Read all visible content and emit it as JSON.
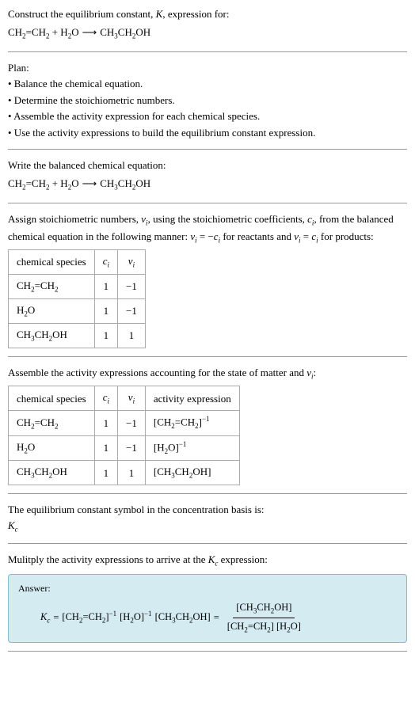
{
  "section1": {
    "intro": "Construct the equilibrium constant, K, expression for:",
    "equation": "CH₂=CH₂ + H₂O ⟶ CH₃CH₂OH"
  },
  "section2": {
    "title": "Plan:",
    "items": [
      "• Balance the chemical equation.",
      "• Determine the stoichiometric numbers.",
      "• Assemble the activity expression for each chemical species.",
      "• Use the activity expressions to build the equilibrium constant expression."
    ]
  },
  "section3": {
    "intro": "Write the balanced chemical equation:",
    "equation": "CH₂=CH₂ + H₂O ⟶ CH₃CH₂OH"
  },
  "section4": {
    "intro_part1": "Assign stoichiometric numbers, ",
    "intro_vi": "νᵢ",
    "intro_part2": ", using the stoichiometric coefficients, ",
    "intro_ci": "cᵢ",
    "intro_part3": ", from the balanced chemical equation in the following manner: ",
    "intro_eq1": "νᵢ = −cᵢ",
    "intro_part4": " for reactants and ",
    "intro_eq2": "νᵢ = cᵢ",
    "intro_part5": " for products:",
    "table": {
      "headers": [
        "chemical species",
        "cᵢ",
        "νᵢ"
      ],
      "rows": [
        [
          "CH₂=CH₂",
          "1",
          "−1"
        ],
        [
          "H₂O",
          "1",
          "−1"
        ],
        [
          "CH₃CH₂OH",
          "1",
          "1"
        ]
      ]
    }
  },
  "section5": {
    "intro": "Assemble the activity expressions accounting for the state of matter and νᵢ:",
    "table": {
      "headers": [
        "chemical species",
        "cᵢ",
        "νᵢ",
        "activity expression"
      ],
      "rows": [
        {
          "species": "CH₂=CH₂",
          "ci": "1",
          "vi": "−1",
          "activity": "[CH₂=CH₂]⁻¹"
        },
        {
          "species": "H₂O",
          "ci": "1",
          "vi": "−1",
          "activity": "[H₂O]⁻¹"
        },
        {
          "species": "CH₃CH₂OH",
          "ci": "1",
          "vi": "1",
          "activity": "[CH₃CH₂OH]"
        }
      ]
    }
  },
  "section6": {
    "intro": "The equilibrium constant symbol in the concentration basis is:",
    "symbol": "K_c"
  },
  "section7": {
    "intro": "Mulitply the activity expressions to arrive at the K_c expression:"
  },
  "answer": {
    "label": "Answer:",
    "kc": "K_c",
    "equals": " = ",
    "term1": "[CH₂=CH₂]⁻¹",
    "term2": "[H₂O]⁻¹",
    "term3": "[CH₃CH₂OH]",
    "equals2": " = ",
    "fraction_num": "[CH₃CH₂OH]",
    "fraction_den": "[CH₂=CH₂] [H₂O]"
  }
}
